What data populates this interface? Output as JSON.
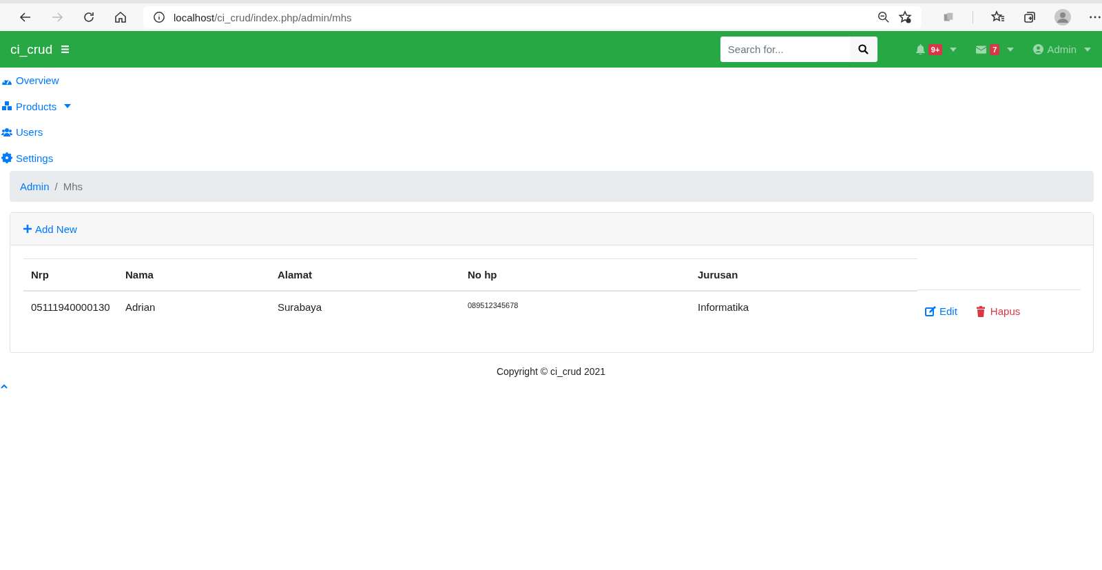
{
  "browser": {
    "url_host": "localhost",
    "url_path": "/ci_crud/index.php/admin/mhs"
  },
  "navbar": {
    "brand": "ci_crud",
    "search": {
      "placeholder": "Search for..."
    },
    "alerts_badge": "9+",
    "messages_badge": "7",
    "user": "Admin"
  },
  "sidebar": {
    "items": [
      {
        "label": "Overview",
        "dropdown": false
      },
      {
        "label": "Products",
        "dropdown": true
      },
      {
        "label": "Users",
        "dropdown": false
      },
      {
        "label": "Settings",
        "dropdown": false
      }
    ]
  },
  "breadcrumb": {
    "separator": "/",
    "items": [
      {
        "label": "Admin",
        "active": false
      },
      {
        "label": "Mhs",
        "active": true
      }
    ]
  },
  "card": {
    "add_button": "Add New",
    "table": {
      "columns": [
        "Nrp",
        "Nama",
        "Alamat",
        "No hp",
        "Jurusan"
      ],
      "rows": [
        {
          "cells": [
            "05111940000130",
            "Adrian",
            "Surabaya",
            "089512345678",
            "Informatika"
          ],
          "actions": [
            {
              "kind": "edit",
              "label": "Edit"
            },
            {
              "kind": "delete",
              "label": "Hapus"
            }
          ]
        }
      ]
    }
  },
  "footer": "Copyright © ci_crud 2021"
}
